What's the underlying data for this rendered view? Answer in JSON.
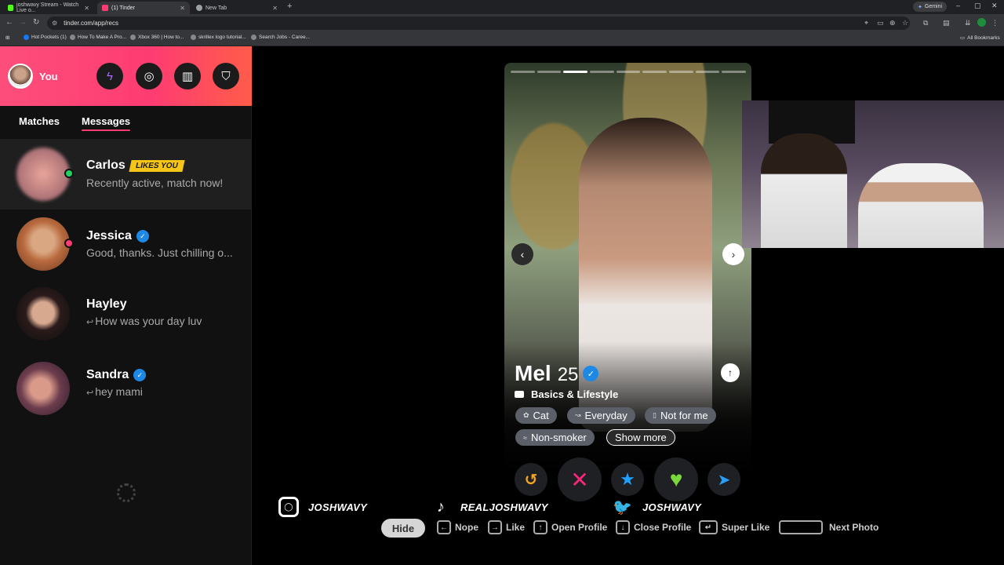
{
  "browser": {
    "tabs": [
      {
        "title": "joshwavy Stream - Watch Live o...",
        "fav_color": "#53fc18"
      },
      {
        "title": "(1) Tinder",
        "fav_color": "#fe3c72"
      },
      {
        "title": "New Tab",
        "fav_color": "#9aa0a6"
      }
    ],
    "new_tab_glyph": "+",
    "gemini_label": "Gemini",
    "url": "tinder.com/app/recs",
    "bookmarks": [
      {
        "label": "Hot Pockets (1)",
        "color": "#1877f2"
      },
      {
        "label": "How To Make A Pro...",
        "color": "#888"
      },
      {
        "label": "Xbox 360 | How to...",
        "color": "#888"
      },
      {
        "label": "skrillex logo tutorial...",
        "color": "#888"
      },
      {
        "label": "Search Jobs - Caree...",
        "color": "#888"
      }
    ],
    "all_bookmarks": "All Bookmarks"
  },
  "sidebar": {
    "me_label": "You",
    "header_icons": [
      "boost-icon",
      "explore-icon",
      "briefcase-icon",
      "shield-icon"
    ],
    "tabs": [
      {
        "label": "Matches",
        "active": false
      },
      {
        "label": "Messages",
        "active": true
      }
    ],
    "matches": [
      {
        "name": "Carlos",
        "badge": "LIKES YOU",
        "message": "Recently active, match now!",
        "status": "#23d160",
        "verified": false,
        "replied": false
      },
      {
        "name": "Jessica",
        "badge": "",
        "message": "Good, thanks. Just chilling o...",
        "status": "#fe3c72",
        "verified": true,
        "replied": false
      },
      {
        "name": "Hayley",
        "badge": "",
        "message": "How was your day luv",
        "status": "",
        "verified": false,
        "replied": true
      },
      {
        "name": "Sandra",
        "badge": "",
        "message": "hey mami",
        "status": "",
        "verified": true,
        "replied": true
      }
    ]
  },
  "card": {
    "photo_count": 9,
    "photo_index": 3,
    "name": "Mel",
    "age": "25",
    "section": "Basics & Lifestyle",
    "chips": [
      "Cat",
      "Everyday",
      "Not for me",
      "Non-smoker"
    ],
    "show_more": "Show more"
  },
  "actions": [
    "rewind-icon",
    "nope-icon",
    "super-like-icon",
    "like-icon",
    "boost-send-icon"
  ],
  "colors": {
    "brand": "#fe3c72",
    "rewind": "#f5a623",
    "nope": "#fd267d",
    "superlike": "#1fa1ff",
    "like": "#7bd83a",
    "send": "#2a9df4"
  },
  "socials": [
    {
      "platform": "instagram",
      "handle": "JOSHWAVY"
    },
    {
      "platform": "tiktok",
      "handle": "REALJOSHWAVY"
    },
    {
      "platform": "twitter",
      "handle": "JOSHWAVY"
    }
  ],
  "shortcuts": {
    "hide": "Hide",
    "items": [
      {
        "key": "←",
        "label": "Nope"
      },
      {
        "key": "→",
        "label": "Like"
      },
      {
        "key": "↑",
        "label": "Open Profile"
      },
      {
        "key": "↓",
        "label": "Close Profile"
      },
      {
        "key": "↵",
        "label": "Super Like"
      },
      {
        "key": "",
        "label": "Next Photo"
      }
    ]
  }
}
